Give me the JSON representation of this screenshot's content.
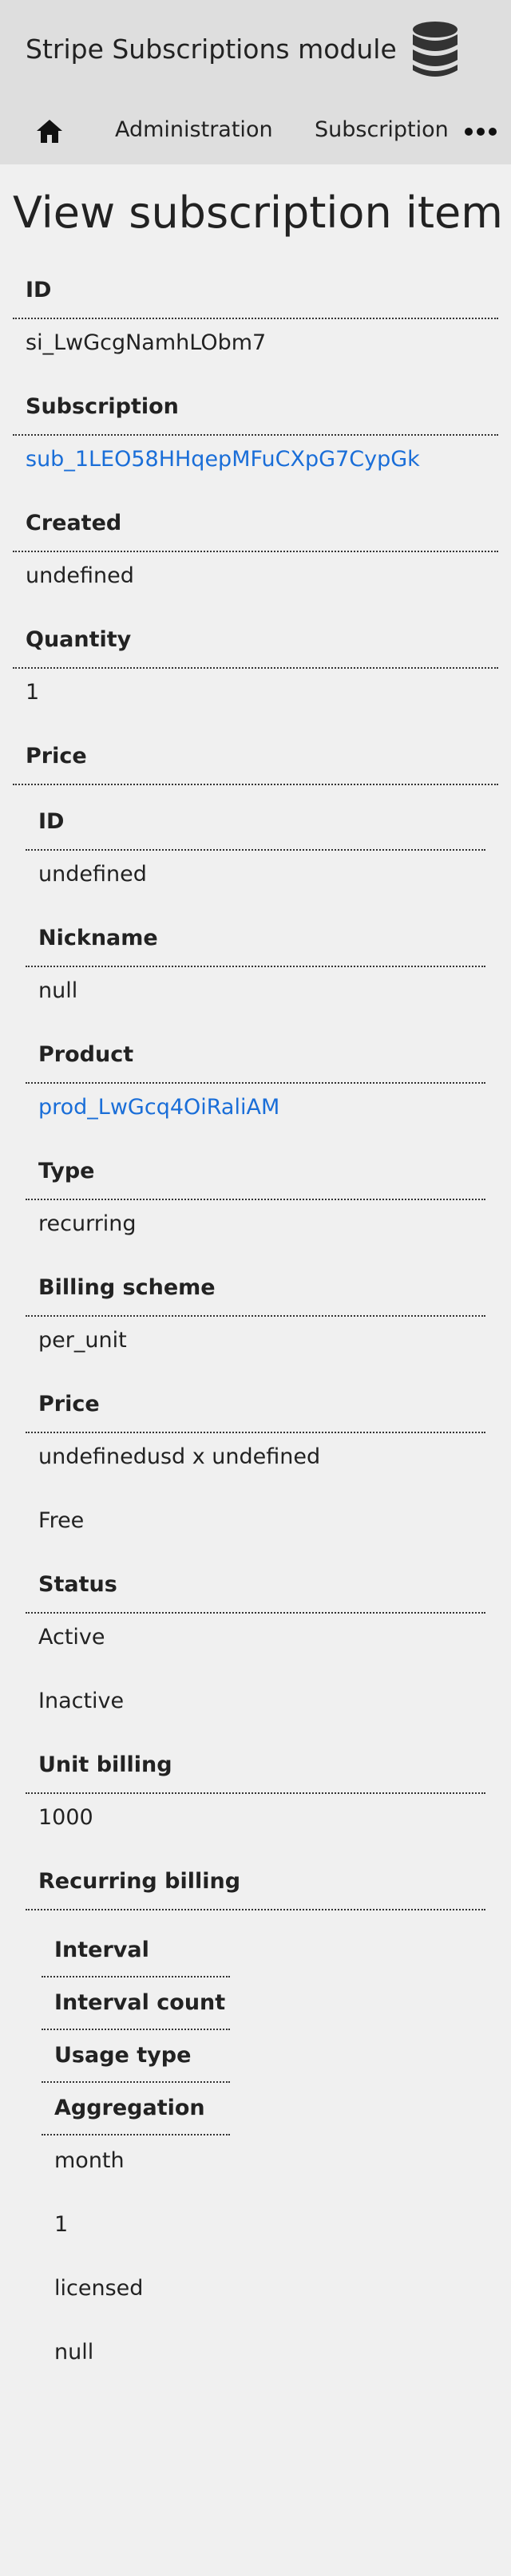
{
  "app": {
    "title": "Stripe Subscriptions module"
  },
  "nav": {
    "administration": "Administration",
    "subscription": "Subscription administration"
  },
  "page": {
    "title": "View subscription item"
  },
  "fields": {
    "id": {
      "label": "ID",
      "value": "si_LwGcgNamhLObm7"
    },
    "subscription": {
      "label": "Subscription",
      "value": "sub_1LEO58HHqepMFuCXpG7CypGk"
    },
    "created": {
      "label": "Created",
      "value": "undefined"
    },
    "quantity": {
      "label": "Quantity",
      "value": "1"
    },
    "price_label": "Price"
  },
  "price": {
    "id": {
      "label": "ID",
      "value": "undefined"
    },
    "nickname": {
      "label": "Nickname",
      "value": "null"
    },
    "product": {
      "label": "Product",
      "value": "prod_LwGcq4OiRaliAM"
    },
    "type": {
      "label": "Type",
      "value": "recurring"
    },
    "billing_scheme": {
      "label": "Billing scheme",
      "value": "per_unit"
    },
    "price": {
      "label": "Price",
      "value": "undefinedusd x undefined",
      "value2": "Free"
    },
    "status": {
      "label": "Status",
      "value": "Active",
      "value2": "Inactive"
    },
    "unit_billing": {
      "label": "Unit billing",
      "value": "1000"
    },
    "recurring_label": "Recurring billing"
  },
  "recurring": {
    "headers": [
      "Interval",
      "Interval count",
      "Usage type",
      "Aggregation"
    ],
    "values": [
      "month",
      "1",
      "licensed",
      "null"
    ]
  }
}
